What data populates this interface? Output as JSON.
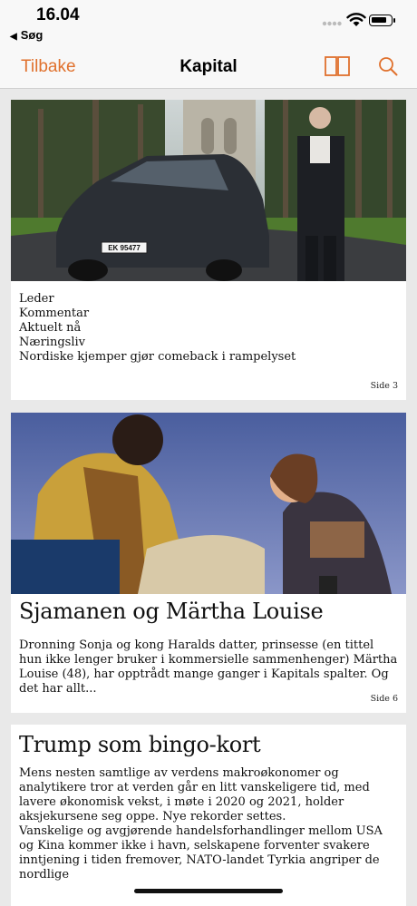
{
  "status": {
    "time": "16.04",
    "back_app": "Søg"
  },
  "nav": {
    "back_label": "Tilbake",
    "title": "Kapital",
    "icons": [
      "book-icon",
      "search-icon"
    ],
    "accent_color": "#e0712d"
  },
  "cards": [
    {
      "sections": [
        "Leder",
        "Kommentar",
        "Aktuelt nå",
        "Næringsliv",
        "Nordiske kjemper gjør comeback i rampelyset"
      ],
      "page": "Side 3",
      "plate": "EK 95477"
    },
    {
      "title": "Sjamanen og Märtha Louise",
      "text": "Dronning Sonja og kong Haralds datter, prinsesse (en tittel hun ikke lenger bruker i kommersielle sammenhenger) Märtha Louise (48), har opptrådt mange ganger i Kapitals spalter. Og det har allt...",
      "page": "Side 6"
    },
    {
      "title": "Trump som bingo-kort",
      "paragraphs": [
        "Mens nesten samtlige av verdens makroøkonomer og analytikere tror at verden går en litt vanskeligere tid, med lavere økonomisk vekst, i møte i 2020 og 2021, holder aksjekursene seg oppe. Nye rekorder settes.",
        "Vanskelige og avgjørende handelsforhandlinger mellom USA og Kina kommer ikke i havn, selskapene forventer svakere inntjening i tiden fremover, NATO-landet Tyrkia angriper de nordlige"
      ]
    }
  ]
}
